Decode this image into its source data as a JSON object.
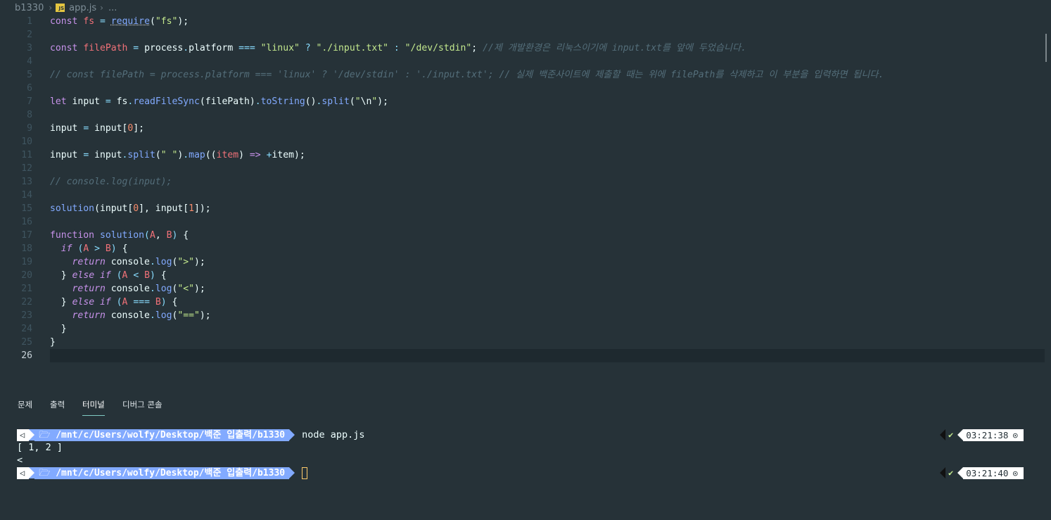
{
  "breadcrumb": {
    "folder": "b1330",
    "file": "app.js",
    "more": "...",
    "file_icon_text": "JS"
  },
  "editor": {
    "active_line": "26"
  },
  "panel": {
    "tabs": [
      "문제",
      "출력",
      "터미널",
      "디버그 콘솔"
    ],
    "active_tab": "터미널"
  },
  "terminal": {
    "prompt_icon": "◁",
    "folder_icon": "🗁",
    "path_prefix": "/mnt/c/Users/wolfy/Desktop/백준 입출력/",
    "path_dir": "b1330",
    "command": "node app.js",
    "output_1": "[ 1, 2 ]",
    "output_2": "<",
    "check": "✔",
    "time_1": "03:21:38",
    "time_2": "03:21:40",
    "clock_icon": "⊙"
  },
  "colors": {
    "background": "#263238",
    "keyword": "#c792ea",
    "function": "#82aaff",
    "string": "#c3e88d",
    "variable": "#f07178",
    "number": "#f78c6c",
    "comment": "#546e7a",
    "prompt_blue": "#82aaff"
  },
  "icons": {
    "chevron": "chevron-right-icon",
    "js": "js-file-icon",
    "folder": "folder-icon",
    "clock": "clock-icon",
    "check": "check-icon"
  }
}
